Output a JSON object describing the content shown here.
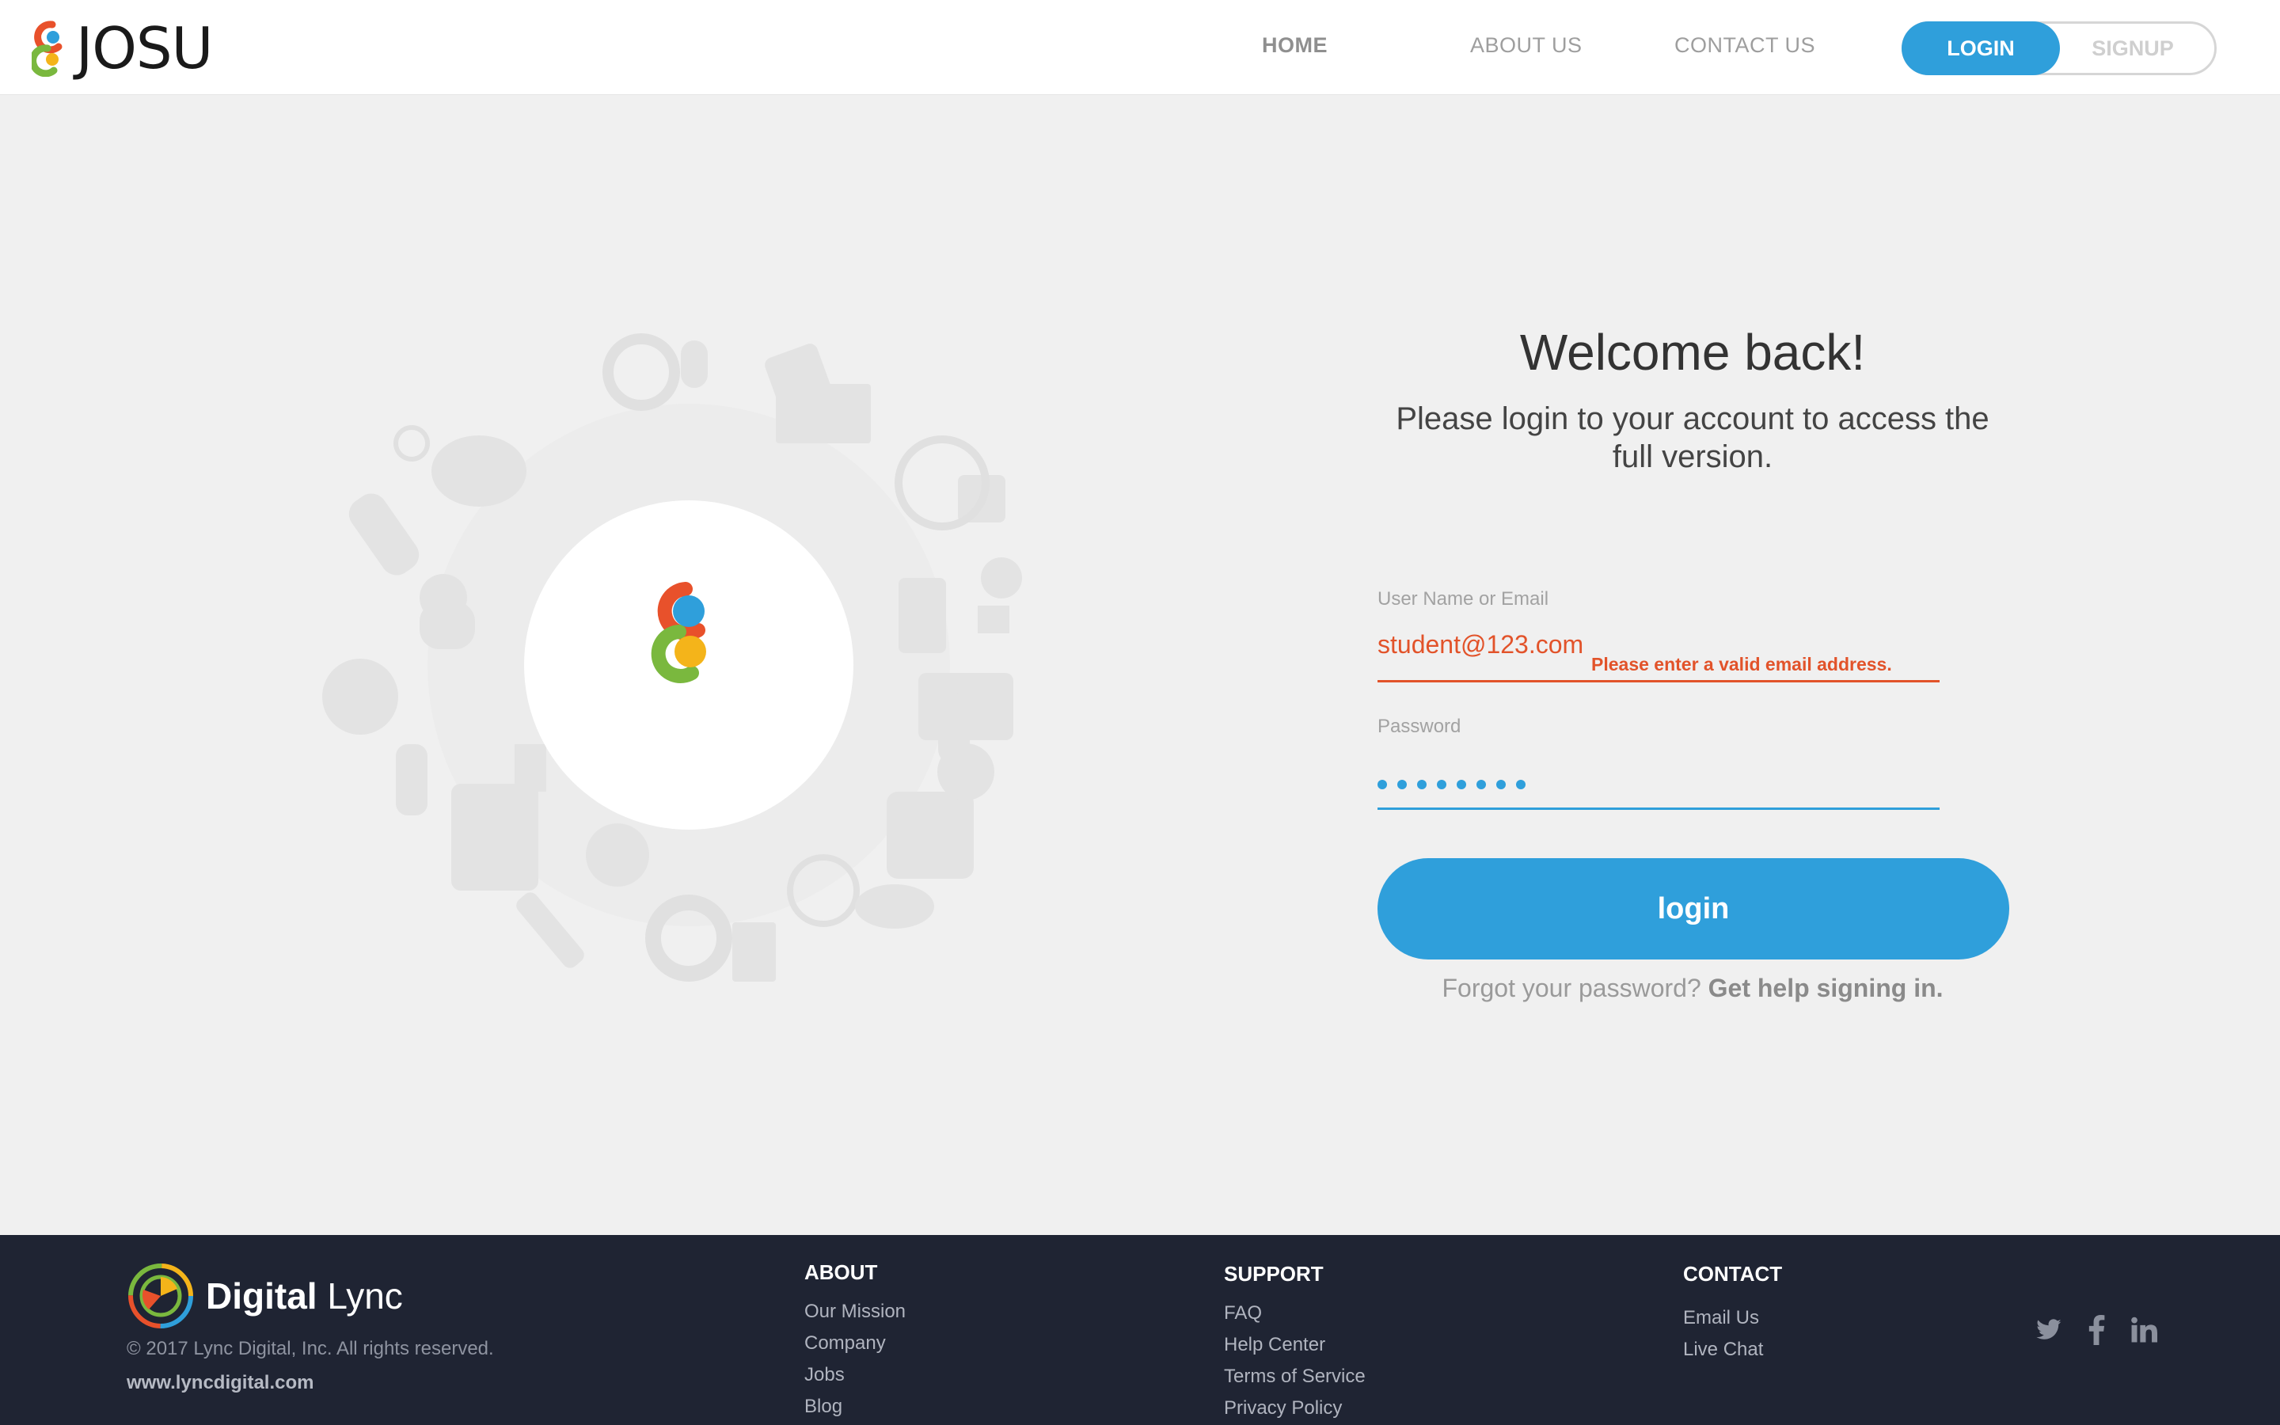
{
  "header": {
    "brand": "JOSU",
    "nav": {
      "home": "HOME",
      "about": "ABOUT US",
      "contact": "CONTACT US"
    },
    "auth": {
      "login": "LOGIN",
      "signup": "SIGNUP"
    }
  },
  "login_form": {
    "title": "Welcome back!",
    "subtitle": "Please login to your account to access the full version.",
    "username": {
      "label": "User Name or Email",
      "value": "student@123.com",
      "error": "Please enter a valid email address."
    },
    "password": {
      "label": "Password",
      "masked_length": 8
    },
    "submit": "login",
    "forgot": {
      "prompt": "Forgot your password?",
      "link": "Get help signing in."
    }
  },
  "footer": {
    "brand": {
      "bold": "Digital",
      "light": " Lync"
    },
    "copyright": "© 2017 Lync Digital, Inc. All rights reserved.",
    "url": "www.lyncdigital.com",
    "about": {
      "title": "ABOUT",
      "links": [
        "Our Mission",
        "Company",
        "Jobs",
        "Blog"
      ]
    },
    "support": {
      "title": "SUPPORT",
      "links": [
        "FAQ",
        "Help Center",
        "Terms of Service",
        "Privacy Policy"
      ]
    },
    "contact": {
      "title": "CONTACT",
      "links": [
        "Email Us",
        "Live Chat"
      ]
    },
    "social": [
      "twitter-icon",
      "facebook-icon",
      "linkedin-icon"
    ]
  },
  "colors": {
    "accent": "#2f9fdb",
    "error": "#e2532a",
    "footer_bg": "#1f2433",
    "logo_red": "#e8512b",
    "logo_green": "#7ab83e",
    "logo_blue": "#2f9fdb",
    "logo_yellow": "#f4b41a"
  }
}
